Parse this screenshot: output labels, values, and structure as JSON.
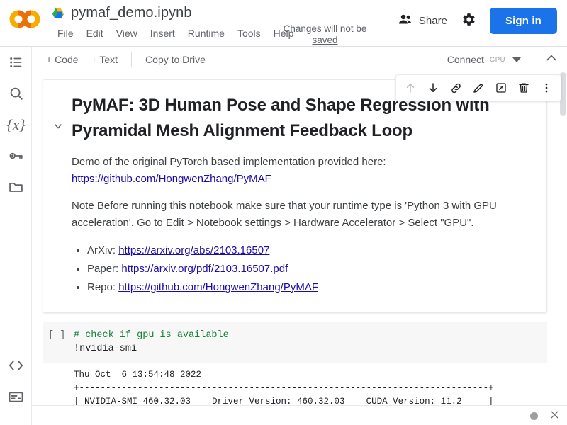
{
  "header": {
    "logo_name": "colab-logo",
    "drive_icon": "google-drive-icon",
    "file_title": "pymaf_demo.ipynb",
    "menu": [
      "File",
      "Edit",
      "View",
      "Insert",
      "Runtime",
      "Tools",
      "Help"
    ],
    "save_note": "Changes will not be saved",
    "share_label": "Share",
    "share_icon": "people-icon",
    "settings_icon": "gear-icon",
    "signin_label": "Sign in",
    "signin_color": "#1a73e8"
  },
  "toolbar": {
    "add_code_label": "+ Code",
    "add_text_label": "+ Text",
    "copy_to_drive_label": "Copy to Drive",
    "connect_label": "Connect",
    "connect_badge": "GPU",
    "chevron_up_icon": "chevron-up-icon",
    "caret_down_icon": "caret-down-icon"
  },
  "sidebar": {
    "items": [
      {
        "name": "table-of-contents-icon",
        "label": "Table of contents"
      },
      {
        "name": "search-icon",
        "label": "Find and replace"
      },
      {
        "name": "variables-icon",
        "label": "Variables"
      },
      {
        "name": "key-icon",
        "label": "Secrets"
      },
      {
        "name": "folder-icon",
        "label": "Files"
      }
    ],
    "bottom_items": [
      {
        "name": "code-snippets-icon",
        "label": "Code snippets"
      },
      {
        "name": "terminal-icon",
        "label": "Terminal"
      }
    ]
  },
  "cell_toolbar": {
    "buttons": [
      {
        "name": "move-cell-up-icon",
        "label": "Move cell up",
        "disabled": true
      },
      {
        "name": "move-cell-down-icon",
        "label": "Move cell down",
        "disabled": false
      },
      {
        "name": "link-to-cell-icon",
        "label": "Link to cell",
        "disabled": false
      },
      {
        "name": "edit-cell-icon",
        "label": "Edit",
        "disabled": false
      },
      {
        "name": "open-in-new-tab-icon",
        "label": "Mirror cell in tab",
        "disabled": false
      },
      {
        "name": "delete-cell-icon",
        "label": "Delete cell",
        "disabled": false
      },
      {
        "name": "more-options-icon",
        "label": "More cell actions",
        "disabled": false
      }
    ]
  },
  "markdown_cell": {
    "collapse_icon": "chevron-down-icon",
    "heading": "PyMAF: 3D Human Pose and Shape Regression with Pyramidal Mesh Alignment Feedback Loop",
    "para1_text": "Demo of the original PyTorch based implementation provided here:",
    "para1_link": "https://github.com/HongwenZhang/PyMAF",
    "para2": "Note Before running this notebook make sure that your runtime type is 'Python 3 with GPU acceleration'. Go to Edit > Notebook settings > Hardware Accelerator > Select \"GPU\".",
    "list": [
      {
        "label": "ArXiv:",
        "link": "https://arxiv.org/abs/2103.16507"
      },
      {
        "label": "Paper:",
        "link": "https://arxiv.org/pdf/2103.16507.pdf"
      },
      {
        "label": "Repo:",
        "link": "https://github.com/HongwenZhang/PyMAF"
      }
    ],
    "link_color": "#1a0dab"
  },
  "code_cell": {
    "run_indicator": "[ ]",
    "comment_line": "# check if gpu is available",
    "code_line": "!nvidia-smi",
    "comment_color": "#188038",
    "output": "Thu Oct  6 13:54:48 2022       \n+-----------------------------------------------------------------------------+\n| NVIDIA-SMI 460.32.03    Driver Version: 460.32.03    CUDA Version: 11.2     |\n|-------------------------------+----------------------+----------------------+"
  },
  "bottom_bar": {
    "status_dot": "status-dot-icon",
    "close_icon": "close-icon"
  },
  "scrollbar": {
    "thumb_name": "vertical-scrollbar-thumb"
  }
}
